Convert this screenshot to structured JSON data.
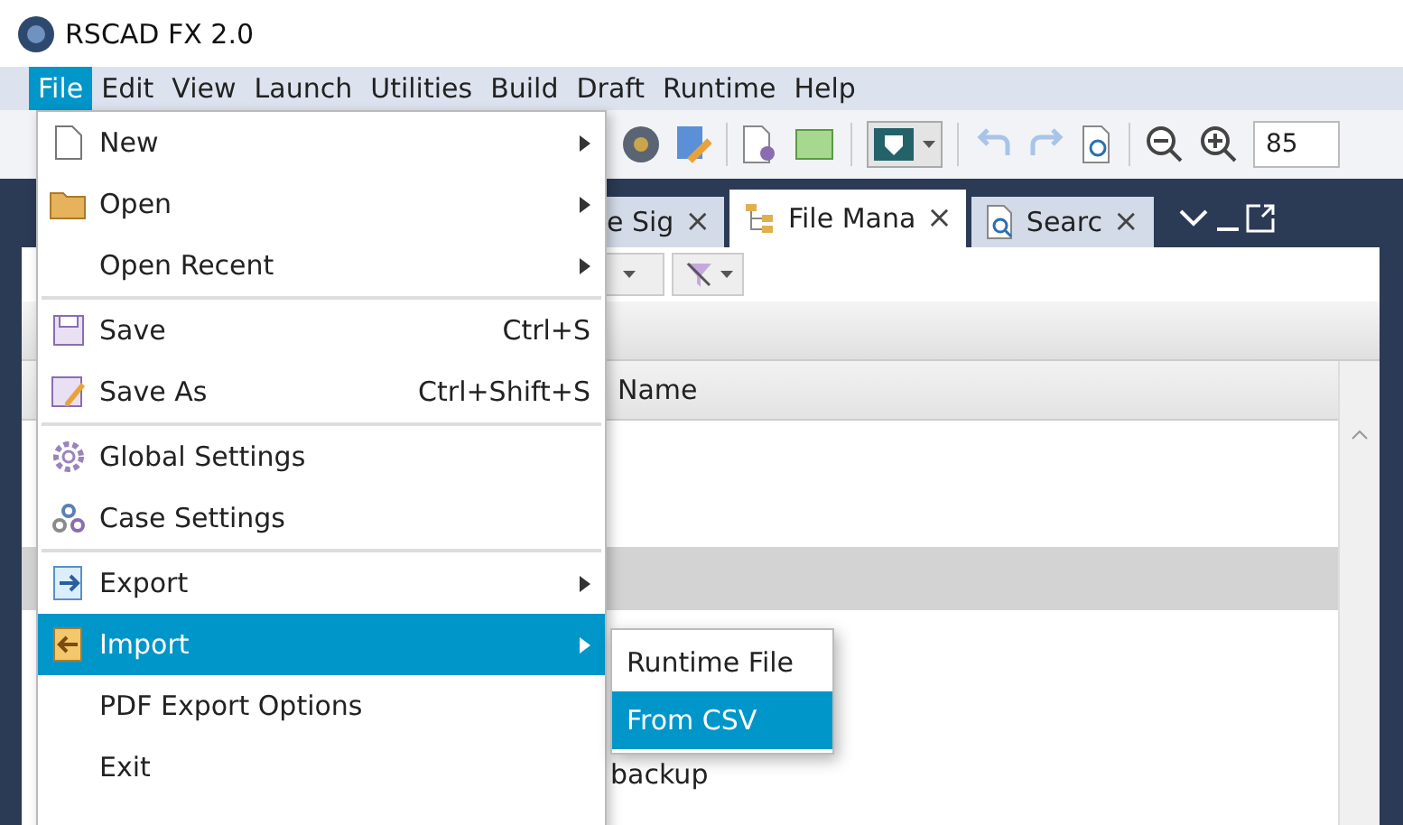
{
  "window": {
    "title": "RSCAD FX 2.0"
  },
  "menubar": [
    {
      "label": "File",
      "selected": true
    },
    {
      "label": "Edit",
      "selected": false
    },
    {
      "label": "View",
      "selected": false
    },
    {
      "label": "Launch",
      "selected": false
    },
    {
      "label": "Utilities",
      "selected": false
    },
    {
      "label": "Build",
      "selected": false
    },
    {
      "label": "Draft",
      "selected": false
    },
    {
      "label": "Runtime",
      "selected": false
    },
    {
      "label": "Help",
      "selected": false
    }
  ],
  "toolbar": {
    "zoom_value": "85"
  },
  "tabs": [
    {
      "label": "e Sig",
      "selected": false,
      "close": "×"
    },
    {
      "label": "File Mana",
      "selected": true,
      "close": "×"
    },
    {
      "label": "Searc",
      "selected": false,
      "close": "×"
    }
  ],
  "table": {
    "columns": [
      "Name"
    ],
    "rows": [
      {
        "selected": true
      },
      {
        "name": "backup",
        "selected": false
      }
    ]
  },
  "file_menu": [
    {
      "kind": "item",
      "label": "New",
      "submenu": true,
      "selected": false
    },
    {
      "kind": "item",
      "label": "Open",
      "submenu": true,
      "selected": false
    },
    {
      "kind": "item",
      "label": "Open Recent",
      "submenu": true,
      "selected": false
    },
    {
      "kind": "separator"
    },
    {
      "kind": "item",
      "label": "Save",
      "shortcut": "Ctrl+S",
      "submenu": false,
      "selected": false
    },
    {
      "kind": "item",
      "label": "Save As",
      "shortcut": "Ctrl+Shift+S",
      "submenu": false,
      "selected": false
    },
    {
      "kind": "separator"
    },
    {
      "kind": "item",
      "label": "Global Settings",
      "submenu": false,
      "selected": false
    },
    {
      "kind": "item",
      "label": "Case Settings",
      "submenu": false,
      "selected": false
    },
    {
      "kind": "separator"
    },
    {
      "kind": "item",
      "label": "Export",
      "submenu": true,
      "selected": false
    },
    {
      "kind": "item",
      "label": "Import",
      "submenu": true,
      "selected": true
    },
    {
      "kind": "item",
      "label": "PDF Export Options",
      "submenu": false,
      "selected": false
    },
    {
      "kind": "item",
      "label": "Exit",
      "submenu": false,
      "selected": false
    }
  ],
  "import_submenu": [
    {
      "label": "Runtime File",
      "selected": false
    },
    {
      "label": "From CSV",
      "selected": true
    }
  ]
}
